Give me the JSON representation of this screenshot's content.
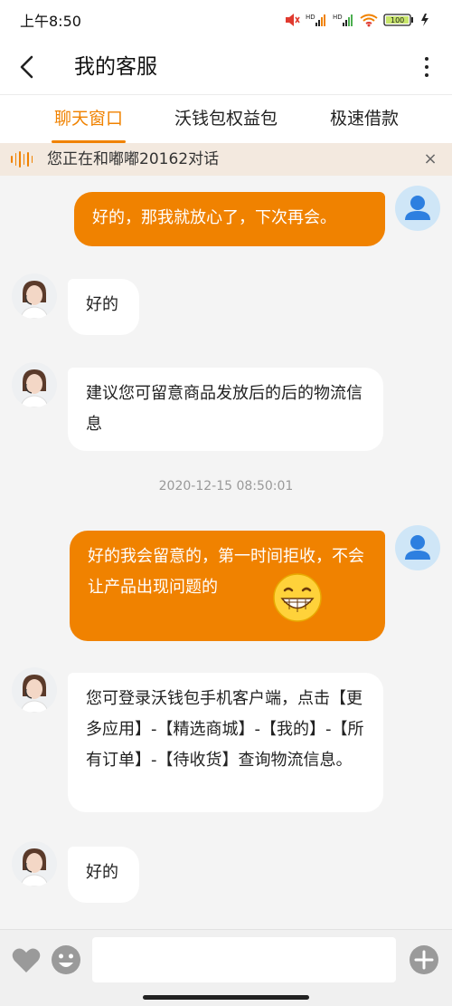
{
  "status_bar": {
    "time": "上午8:50",
    "network_1": "HD",
    "network_2": "HD",
    "battery": "100"
  },
  "header": {
    "title": "我的客服",
    "back_icon": "chevron-left-icon",
    "more_icon": "more-vertical-icon"
  },
  "tabs": [
    {
      "label": "聊天窗口",
      "active": true
    },
    {
      "label": "沃钱包权益包",
      "active": false
    },
    {
      "label": "极速借款",
      "active": false
    }
  ],
  "notice": {
    "text": "您正在和嘟嘟20162对话",
    "close": "×"
  },
  "messages": [
    {
      "from": "user",
      "text": "好的，那我就放心了，下次再会。"
    },
    {
      "from": "agent",
      "text": "好的"
    },
    {
      "from": "agent",
      "text": "建议您可留意商品发放后的后的物流信息"
    },
    {
      "from": "timestamp",
      "text": "2020-12-15 08:50:01"
    },
    {
      "from": "user",
      "text": "好的我会留意的，第一时间拒收，不会让产品出现问题的",
      "emoji": "grinning-face"
    },
    {
      "from": "agent",
      "text": "您可登录沃钱包手机客户端，点击【更多应用】-【精选商城】-【我的】-【所有订单】-【待收货】查询物流信息。"
    },
    {
      "from": "agent",
      "text": "好的"
    }
  ],
  "input_bar": {
    "placeholder": ""
  },
  "colors": {
    "accent": "#f08200",
    "background": "#f4f4f4"
  }
}
